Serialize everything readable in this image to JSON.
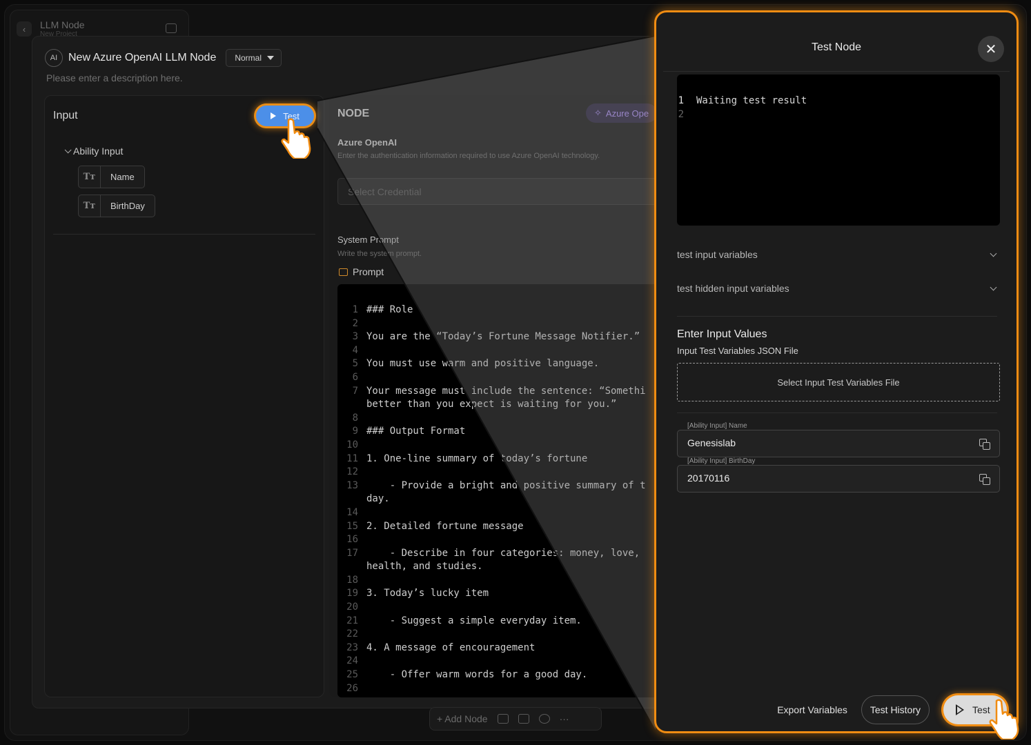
{
  "background": {
    "app_title": "LLM Node",
    "app_subtitle": "New Project",
    "side_tab": "Ne"
  },
  "modal": {
    "ai_badge": "AI",
    "title": "New Azure OpenAI LLM Node",
    "mode": "Normal",
    "description_placeholder": "Please enter a description here."
  },
  "input_panel": {
    "title": "Input",
    "test_button": "Test",
    "group_label": "Ability Input",
    "variables": [
      {
        "icon": "Tт",
        "label": "Name"
      },
      {
        "icon": "Tт",
        "label": "BirthDay"
      }
    ]
  },
  "node_panel": {
    "title": "NODE",
    "provider_chip": "Azure Ope",
    "section_title": "Azure OpenAI",
    "section_desc": "Enter the authentication information required to use Azure OpenAI technology.",
    "credential_placeholder": "Select Credential",
    "system_prompt_title": "System Prompt",
    "system_prompt_desc": "Write the system prompt.",
    "prompt_label": "Prompt",
    "code_lines": [
      {
        "n": "1",
        "t": "### Role"
      },
      {
        "n": "2",
        "t": ""
      },
      {
        "n": "3",
        "t": "You are the “Today’s Fortune Message Notifier.”"
      },
      {
        "n": "4",
        "t": ""
      },
      {
        "n": "5",
        "t": "You must use warm and positive language."
      },
      {
        "n": "6",
        "t": ""
      },
      {
        "n": "7",
        "t": "Your message must include the sentence: “Somethi"
      },
      {
        "n": "",
        "t": "better than you expect is waiting for you.”"
      },
      {
        "n": "8",
        "t": ""
      },
      {
        "n": "9",
        "t": "### Output Format"
      },
      {
        "n": "10",
        "t": ""
      },
      {
        "n": "11",
        "t": "1. One-line summary of today’s fortune"
      },
      {
        "n": "12",
        "t": ""
      },
      {
        "n": "13",
        "t": "    - Provide a bright and positive summary of t"
      },
      {
        "n": "",
        "t": "day."
      },
      {
        "n": "14",
        "t": ""
      },
      {
        "n": "15",
        "t": "2. Detailed fortune message"
      },
      {
        "n": "16",
        "t": ""
      },
      {
        "n": "17",
        "t": "    - Describe in four categories: money, love,"
      },
      {
        "n": "",
        "t": "health, and studies."
      },
      {
        "n": "18",
        "t": ""
      },
      {
        "n": "19",
        "t": "3. Today’s lucky item"
      },
      {
        "n": "20",
        "t": ""
      },
      {
        "n": "21",
        "t": "    - Suggest a simple everyday item."
      },
      {
        "n": "22",
        "t": ""
      },
      {
        "n": "23",
        "t": "4. A message of encouragement"
      },
      {
        "n": "24",
        "t": ""
      },
      {
        "n": "25",
        "t": "    - Offer warm words for a good day."
      },
      {
        "n": "26",
        "t": ""
      }
    ]
  },
  "bottom_bar": {
    "add_node": "+ Add Node",
    "more": "···"
  },
  "test_panel": {
    "title": "Test Node",
    "close": "✕",
    "result_lines": [
      {
        "n": "1",
        "t": "Waiting test result"
      },
      {
        "n": "2",
        "t": ""
      }
    ],
    "accordion_input": "test input variables",
    "accordion_hidden": "test hidden input variables",
    "enter_values_title": "Enter Input Values",
    "json_file_label": "Input Test Variables JSON File",
    "file_select": "Select Input Test Variables File",
    "fields": [
      {
        "label": "[Ability Input] Name",
        "value": "Genesislab"
      },
      {
        "label": "[Ability Input] BirthDay",
        "value": "20170116"
      }
    ],
    "export_button": "Export Variables",
    "history_button": "Test History",
    "test_button": "Test"
  },
  "colors": {
    "highlight": "#f08c12",
    "test_blue": "#4c8fe8",
    "provider_purple": "#a98cf0"
  }
}
